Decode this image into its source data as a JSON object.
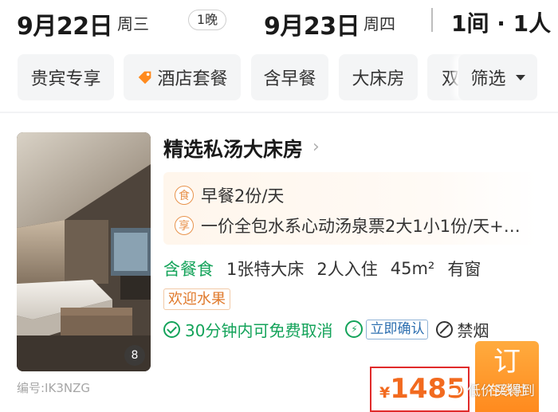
{
  "header": {
    "checkin_date": "9月22日",
    "checkin_weekday": "周三",
    "nights": "1晚",
    "checkout_date": "9月23日",
    "checkout_weekday": "周四",
    "rooms_guests": "1间 · 1人"
  },
  "filters": {
    "chips": [
      "贵宾专享",
      "酒店套餐",
      "含早餐",
      "大床房",
      "双"
    ],
    "filter_label": "筛选"
  },
  "room": {
    "title": "精选私汤大床房",
    "photo_count": "8",
    "code": "编号:IK3NZG",
    "perks": [
      {
        "badge": "食",
        "text": "早餐2份/天"
      },
      {
        "badge": "享",
        "text": "一价全包水系心动汤泉票2大1小1份/天+…"
      }
    ],
    "meal": "含餐食",
    "bed": "1张特大床",
    "occupancy": "2人入住",
    "area": "45m²",
    "window": "有窗",
    "tag": "欢迎水果",
    "cancel_policy": "30分钟内可免费取消",
    "instant_confirm": "立即确认",
    "smoking": "禁烟",
    "currency": "¥",
    "price": "1485",
    "book_label": "订",
    "book_sublabel": "在线付"
  },
  "watermark": "低价买得到",
  "colors": {
    "accent_orange": "#ff8a1e",
    "price_orange": "#f26a1f",
    "green": "#14a35a",
    "highlight_red": "#e02a2a"
  }
}
